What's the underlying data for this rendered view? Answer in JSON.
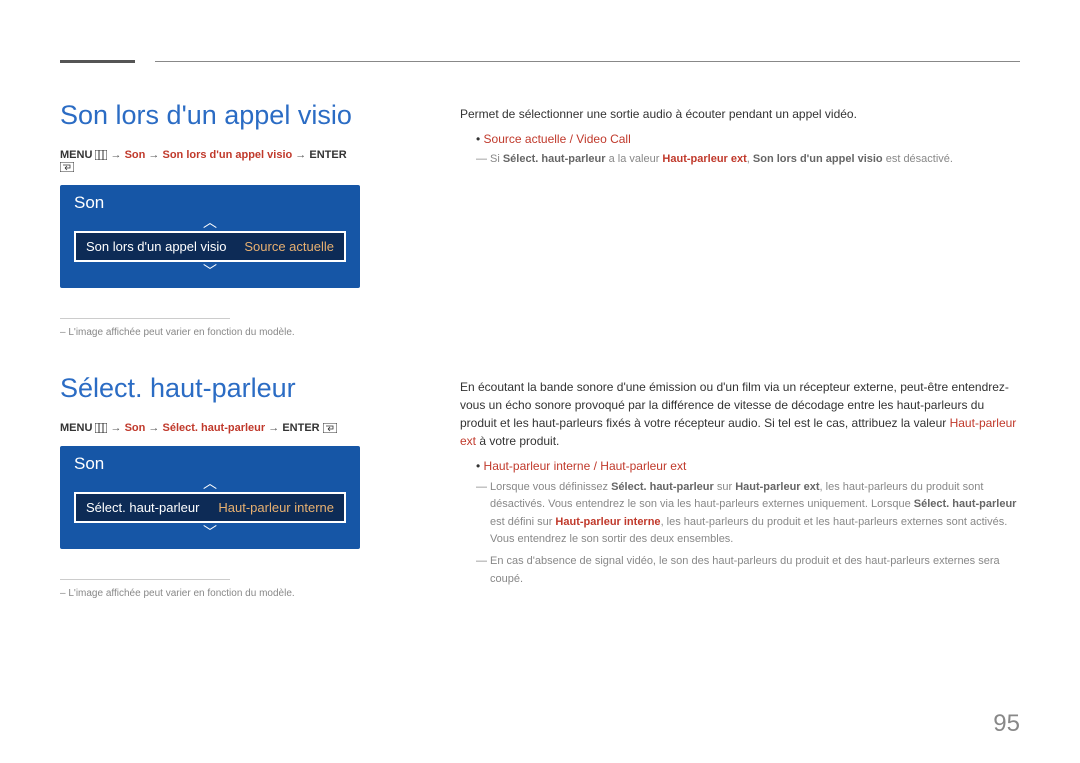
{
  "page_number": "95",
  "section1": {
    "title": "Son lors d'un appel visio",
    "menu_path": {
      "prefix": "MENU",
      "p1": "Son",
      "p2": "Son lors d'un appel visio",
      "suffix": "ENTER"
    },
    "osd": {
      "header": "Son",
      "row_label": "Son lors d'un appel visio",
      "row_value": "Source actuelle"
    },
    "footnote": "L'image affichée peut varier en fonction du modèle.",
    "right": {
      "intro": "Permet de sélectionner une sortie audio à écouter pendant un appel vidéo.",
      "bullet1": "Source actuelle / Video Call",
      "note_parts": {
        "t1": "Si ",
        "b1": "Sélect. haut-parleur",
        "t2": " a la valeur ",
        "a1": "Haut-parleur ext",
        "t3": ", ",
        "b2": "Son lors d'un appel visio",
        "t4": " est désactivé."
      }
    }
  },
  "section2": {
    "title": "Sélect. haut-parleur",
    "menu_path": {
      "prefix": "MENU",
      "p1": "Son",
      "p2": "Sélect. haut-parleur",
      "suffix": "ENTER"
    },
    "osd": {
      "header": "Son",
      "row_label": "Sélect. haut-parleur",
      "row_value": "Haut-parleur interne"
    },
    "footnote": "L'image affichée peut varier en fonction du modèle.",
    "right": {
      "intro_parts": {
        "t1": "En écoutant la bande sonore d'une émission ou d'un film via un récepteur externe, peut-être entendrez-vous un écho sonore provoqué par la différence de vitesse de décodage entre les haut-parleurs du produit et les haut-parleurs fixés à votre récepteur audio. Si tel est le cas, attribuez la valeur ",
        "a1": "Haut-parleur ext",
        "t2": " à votre produit."
      },
      "bullet1": "Haut-parleur interne / Haut-parleur ext",
      "note1_parts": {
        "t1": "Lorsque vous définissez ",
        "b1": "Sélect. haut-parleur",
        "t2": " sur ",
        "b2": "Haut-parleur ext",
        "t3": ", les haut-parleurs du produit sont désactivés. Vous entendrez le son via les haut-parleurs externes uniquement. Lorsque ",
        "b3": "Sélect. haut-parleur",
        "t4": " est défini sur ",
        "a1": "Haut-parleur interne",
        "t5": ", les haut-parleurs du produit et les haut-parleurs externes sont activés. Vous entendrez le son sortir des deux ensembles."
      },
      "note2": "En cas d'absence de signal vidéo, le son des haut-parleurs du produit et des haut-parleurs externes sera coupé."
    }
  }
}
